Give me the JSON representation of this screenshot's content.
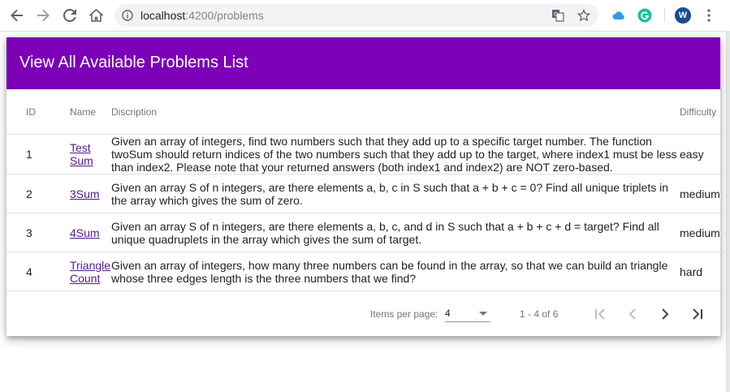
{
  "browser": {
    "url_host": "localhost",
    "url_path": ":4200/problems",
    "profile_initial": "W"
  },
  "header": {
    "title": "View All Available Problems List"
  },
  "table": {
    "columns": {
      "id": "ID",
      "name": "Name",
      "description": "Discription",
      "difficulty": "Difficulty"
    },
    "rows": [
      {
        "id": "1",
        "name_line1": "Test",
        "name_line2": "Sum",
        "description": "Given an array of integers, find two numbers such that they add up to a specific target number. The function twoSum should return indices of the two numbers such that they add up to the target, where index1 must be less than index2. Please note that your returned answers (both index1 and index2) are NOT zero-based.",
        "difficulty": "easy"
      },
      {
        "id": "2",
        "name_line1": "3Sum",
        "name_line2": "",
        "description": "Given an array S of n integers, are there elements a, b, c in S such that a + b + c = 0? Find all unique triplets in the array which gives the sum of zero.",
        "difficulty": "medium"
      },
      {
        "id": "3",
        "name_line1": "4Sum",
        "name_line2": "",
        "description": "Given an array S of n integers, are there elements a, b, c, and d in S such that a + b + c + d = target? Find all unique quadruplets in the array which gives the sum of target.",
        "difficulty": "medium"
      },
      {
        "id": "4",
        "name_line1": "Triangle",
        "name_line2": "Count",
        "description": "Given an array of integers, how many three numbers can be found in the array, so that we can build an triangle whose three edges length is the three numbers that we find?",
        "difficulty": "hard"
      }
    ]
  },
  "paginator": {
    "items_per_page_label": "Items per page:",
    "items_per_page_value": "4",
    "range_label": "1 - 4 of 6"
  },
  "colors": {
    "toolbar": "#7b00b8",
    "link": "#551a8b"
  }
}
